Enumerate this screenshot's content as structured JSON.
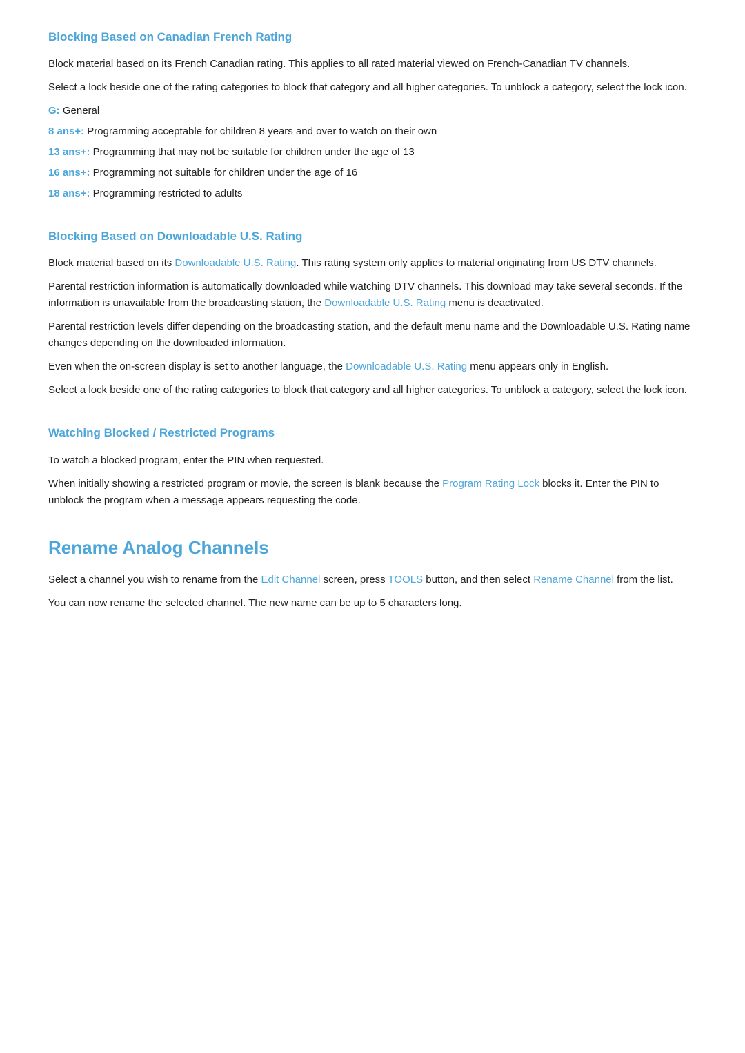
{
  "section1": {
    "title": "Blocking Based on Canadian French Rating",
    "para1": "Block material based on its French Canadian rating. This applies to all rated material viewed on French-Canadian TV channels.",
    "para2": "Select a lock beside one of the rating categories to block that category and all higher categories. To unblock a category, select the lock icon.",
    "ratings": [
      {
        "label": "G:",
        "description": "General"
      },
      {
        "label": "8 ans+:",
        "description": "Programming acceptable for children 8 years and over to watch on their own"
      },
      {
        "label": "13 ans+:",
        "description": "Programming that may not be suitable for children under the age of 13"
      },
      {
        "label": "16 ans+:",
        "description": "Programming not suitable for children under the age of 16"
      },
      {
        "label": "18 ans+:",
        "description": "Programming restricted to adults"
      }
    ]
  },
  "section2": {
    "title": "Blocking Based on Downloadable U.S. Rating",
    "para1_before": "Block material based on its ",
    "para1_link": "Downloadable U.S. Rating",
    "para1_after": ". This rating system only applies to material originating from US DTV channels.",
    "para2_before": "Parental restriction information is automatically downloaded while watching DTV channels. This download may take several seconds. If the information is unavailable from the broadcasting station, the ",
    "para2_link": "Downloadable U.S. Rating",
    "para2_after": " menu is deactivated.",
    "para3": "Parental restriction levels differ depending on the broadcasting station, and the default menu name and the Downloadable U.S. Rating name changes depending on the downloaded information.",
    "para4_before": "Even when the on-screen display is set to another language, the ",
    "para4_link": "Downloadable U.S. Rating",
    "para4_after": " menu appears only in English.",
    "para5": "Select a lock beside one of the rating categories to block that category and all higher categories. To unblock a category, select the lock icon."
  },
  "section3": {
    "title": "Watching Blocked / Restricted Programs",
    "para1": "To watch a blocked program, enter the PIN when requested.",
    "para2_before": "When initially showing a restricted program or movie, the screen is blank because the ",
    "para2_link": "Program Rating Lock",
    "para2_after": " blocks it. Enter the PIN to unblock the program when a message appears requesting the code."
  },
  "section4": {
    "title": "Rename Analog Channels",
    "para1_before": "Select a channel you wish to rename from the ",
    "para1_link1": "Edit Channel",
    "para1_middle": " screen, press ",
    "para1_link2": "TOOLS",
    "para1_middle2": " button, and then select ",
    "para1_link3": "Rename Channel",
    "para1_after": " from the list.",
    "para2": "You can now rename the selected channel. The new name can be up to 5 characters long."
  }
}
